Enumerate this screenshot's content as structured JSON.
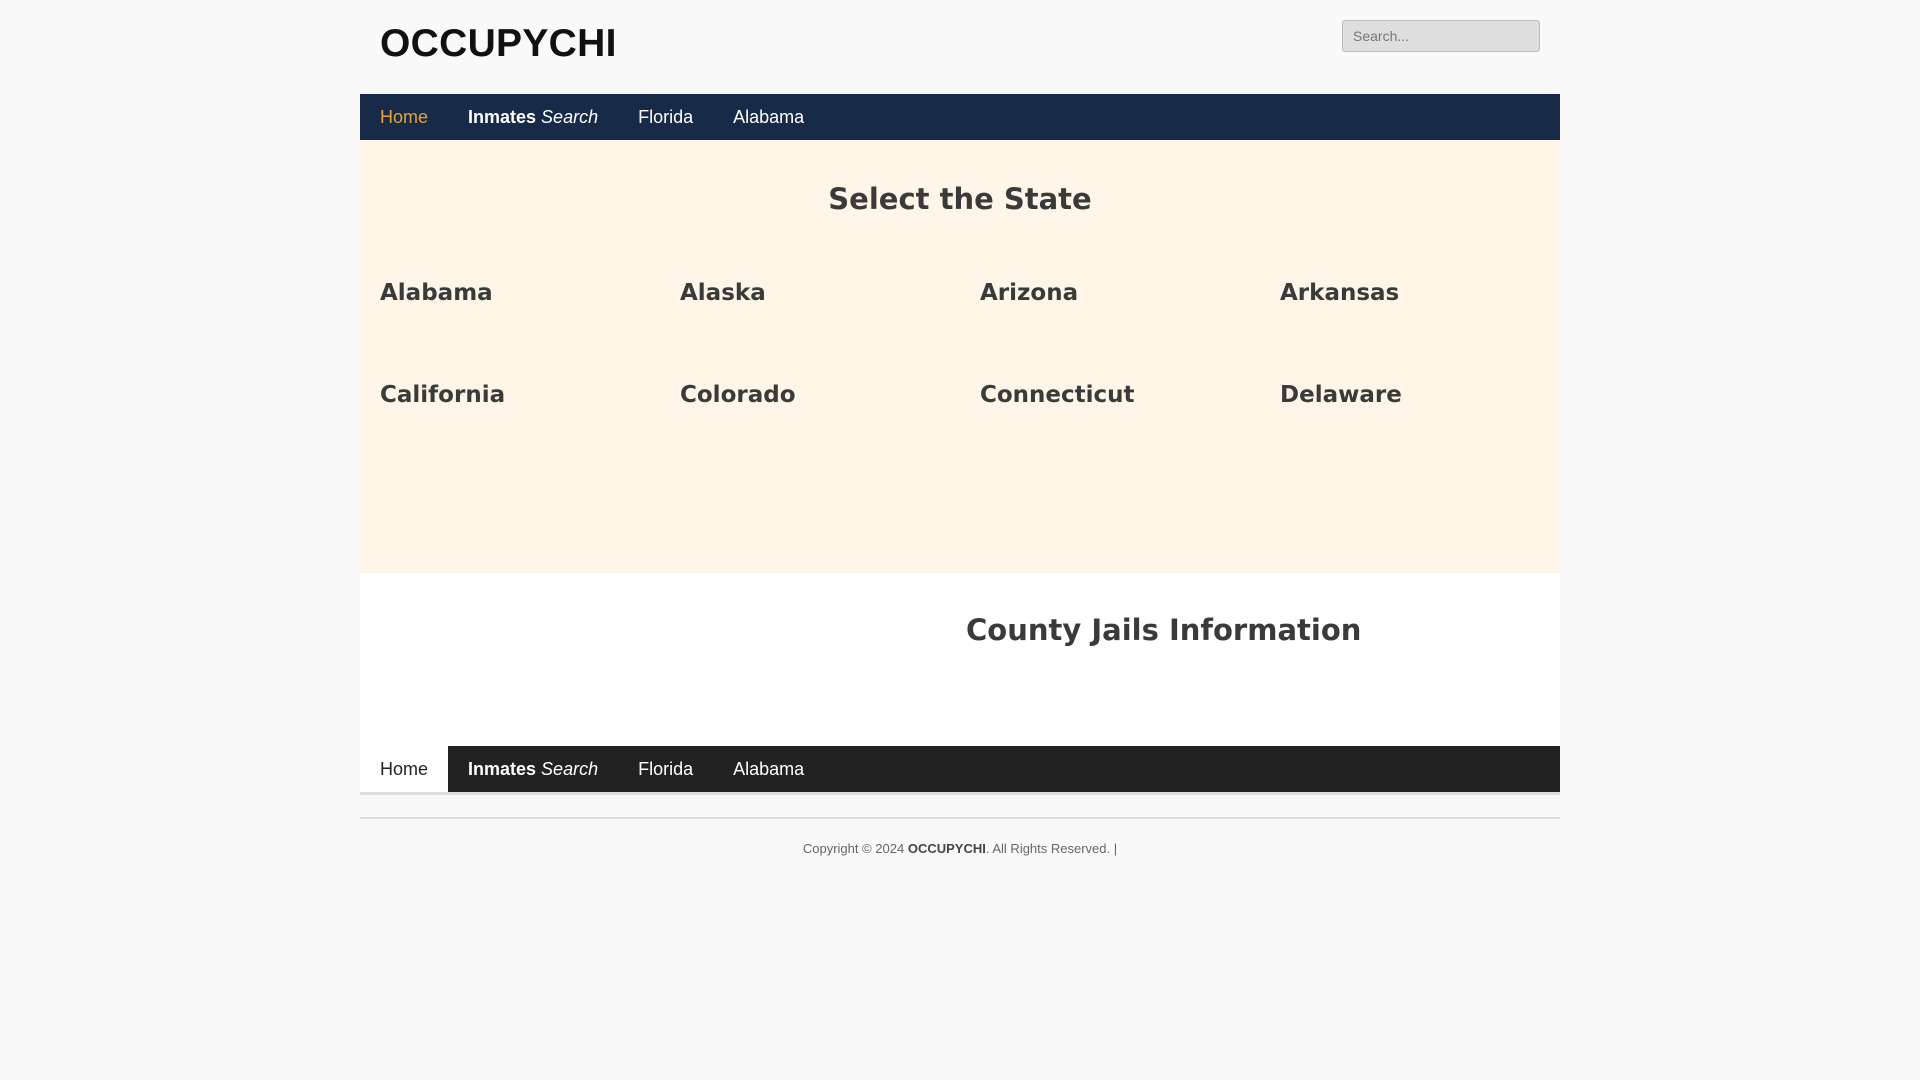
{
  "header": {
    "logo": "OCCUPYCHI",
    "search_placeholder": "Search..."
  },
  "nav_top": {
    "items": [
      {
        "label": "Home",
        "active": true
      },
      {
        "bold": "Inmates",
        "italic": "Search"
      },
      {
        "label": "Florida"
      },
      {
        "label": "Alabama"
      }
    ]
  },
  "states": {
    "title": "Select the State",
    "list": [
      "Alabama",
      "Alaska",
      "Arizona",
      "Arkansas",
      "California",
      "Colorado",
      "Connecticut",
      "Delaware"
    ]
  },
  "county": {
    "title": "County Jails Information"
  },
  "nav_bottom": {
    "items": [
      {
        "label": "Home",
        "active": true
      },
      {
        "bold": "Inmates",
        "italic": "Search"
      },
      {
        "label": "Florida"
      },
      {
        "label": "Alabama"
      }
    ]
  },
  "footer": {
    "copyright_prefix": "Copyright © 2024",
    "brand": "OCCUPYCHI",
    "copyright_suffix": ". All Rights Reserved. |"
  },
  "colors": {
    "nav_top_bg": "#172a47",
    "nav_bottom_bg": "#222222",
    "active_link": "#e8a33d",
    "states_bg": "#fef5e8"
  }
}
